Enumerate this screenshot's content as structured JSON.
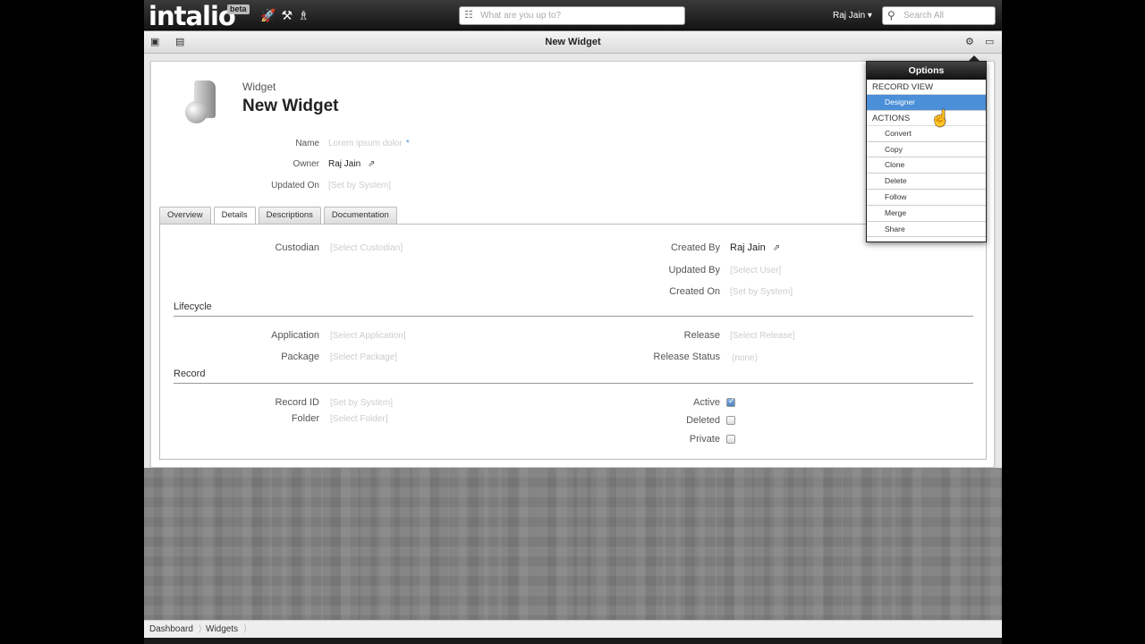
{
  "app": {
    "logo": "intalio",
    "badge": "beta",
    "user": "Raj Jain ▾"
  },
  "top_search": {
    "placeholder": "What are you up to?"
  },
  "search_all": {
    "placeholder": "Search All"
  },
  "toolbar": {
    "title": "New Widget"
  },
  "record": {
    "entity": "Widget",
    "name": "New Widget"
  },
  "header_fields": {
    "name_label": "Name",
    "name_placeholder": "Lorem ipsum dolor",
    "required_mark": "*",
    "owner_label": "Owner",
    "owner_value": "Raj Jain",
    "updated_on_label": "Updated On",
    "updated_on_value": "[Set by System]"
  },
  "tabs": [
    "Overview",
    "Details",
    "Descriptions",
    "Documentation"
  ],
  "details": {
    "custodian_label": "Custodian",
    "custodian_value": "[Select Custodian]",
    "created_by_label": "Created By",
    "created_by_value": "Raj Jain",
    "updated_by_label": "Updated By",
    "updated_by_value": "[Select User]",
    "created_on_label": "Created On",
    "created_on_value": "[Set by System]",
    "lifecycle_title": "Lifecycle",
    "application_label": "Application",
    "application_value": "[Select Application]",
    "release_label": "Release",
    "release_value": "[Select Release]",
    "package_label": "Package",
    "package_value": "[Select Package]",
    "release_status_label": "Release Status",
    "release_status_value": "(none)",
    "record_title": "Record",
    "record_id_label": "Record ID",
    "record_id_value": "[Set by System]",
    "folder_label": "Folder",
    "folder_value": "[Select Folder]",
    "active_label": "Active",
    "active_checked": true,
    "deleted_label": "Deleted",
    "deleted_checked": false,
    "private_label": "Private",
    "private_checked": false
  },
  "options": {
    "title": "Options",
    "record_view_title": "RECORD VIEW",
    "record_view_items": [
      "Designer"
    ],
    "actions_title": "ACTIONS",
    "action_items": [
      "Convert",
      "Copy",
      "Clone",
      "Delete",
      "Follow",
      "Merge",
      "Share"
    ]
  },
  "breadcrumbs": [
    "Dashboard",
    "Widgets"
  ],
  "colors": {
    "accent": "#4a8fd8",
    "topbar": "#1e1e1e"
  },
  "icons": [
    "rocket-icon",
    "tools-icon",
    "agent-icon",
    "rss-icon",
    "search-icon",
    "save-icon",
    "list-icon",
    "gear-icon",
    "window-icon",
    "share-icon"
  ]
}
